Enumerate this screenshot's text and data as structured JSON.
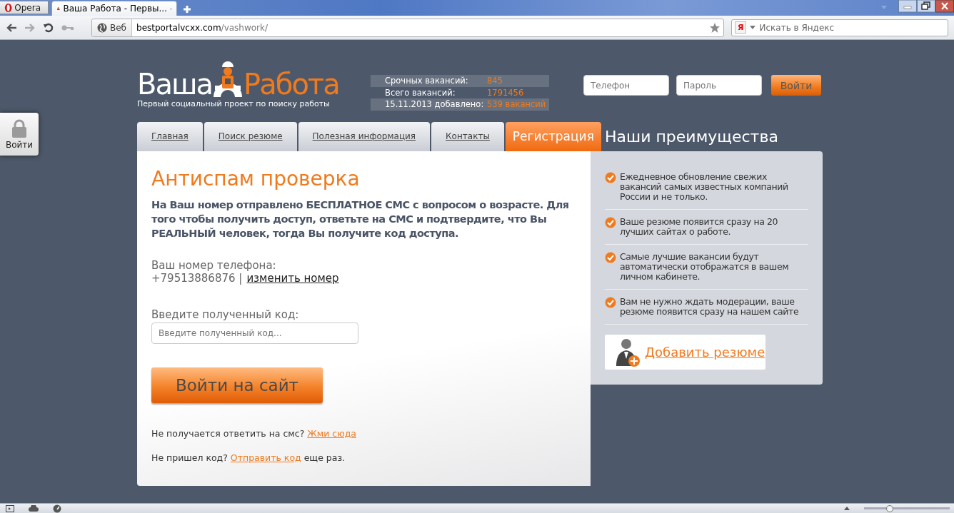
{
  "browser": {
    "menu_label": "Opera",
    "tabs": [
      {
        "label": "Ваша Работа - Первы...",
        "selected": true
      }
    ],
    "address": {
      "site_label": "Веб",
      "domain": "bestportalvcxx.com",
      "path": "/vashwork/"
    },
    "search": {
      "engine_glyph": "Я",
      "placeholder": "Искать в Яндекс"
    },
    "zoom": {
      "level": 0.3
    }
  },
  "header": {
    "logo_left": "Ваша",
    "logo_right": "Работа",
    "tagline": "Первый социальный проект по поиску работы",
    "stats": [
      {
        "label": "Срочных вакансий:",
        "value": "845"
      },
      {
        "label": "Всего вакансий:",
        "value": "1791456"
      },
      {
        "label": "15.11.2013 добавлено:",
        "value": "539 вакансий"
      }
    ],
    "login": {
      "phone_placeholder": "Телефон",
      "password_placeholder": "Пароль",
      "button": "Войти"
    }
  },
  "side_login": {
    "label": "Войти"
  },
  "nav": [
    {
      "label": "Главная",
      "selected": false
    },
    {
      "label": "Поиск резюме",
      "selected": false
    },
    {
      "label": "Полезная информация",
      "selected": false
    },
    {
      "label": "Контакты",
      "selected": false
    },
    {
      "label": "Регистрация",
      "selected": true
    }
  ],
  "main": {
    "title": "Антиспам проверка",
    "message": "На Ваш номер отправлено БЕСПЛАТНОЕ СМС с вопросом о возрасте. Для того чтобы получить доступ, ответьте на СМС и подтвердите, что Вы РЕАЛЬНЫЙ человек, тогда Вы получите код доступа.",
    "phone_label": "Ваш номер телефона:",
    "phone": "+79513886876 |",
    "change_link": "изменить номер",
    "code_label": "Введите полученный код:",
    "code_placeholder": "Введите полученный код...",
    "submit": "Войти на сайт",
    "help": [
      {
        "before": "Не получается ответить на смс? ",
        "link": "Жми сюда"
      },
      {
        "before": "Не пришел код? ",
        "link": "Отправить код",
        "after": " еще раз."
      }
    ]
  },
  "advantages": {
    "title": "Наши преимущества",
    "items": [
      "Ежедневное обновление свежих вакансий самых известных компаний России и не только.",
      "Ваше резюме появится сразу на 20 лучших сайтах о работе.",
      "Самые лучшие вакансии будут автоматически отображатся в вашем личном кабинете.",
      "Вам не нужно ждать модерации, ваше резюме появится сразу на нашем сайте"
    ],
    "add_resume": "Добавить резюме"
  }
}
